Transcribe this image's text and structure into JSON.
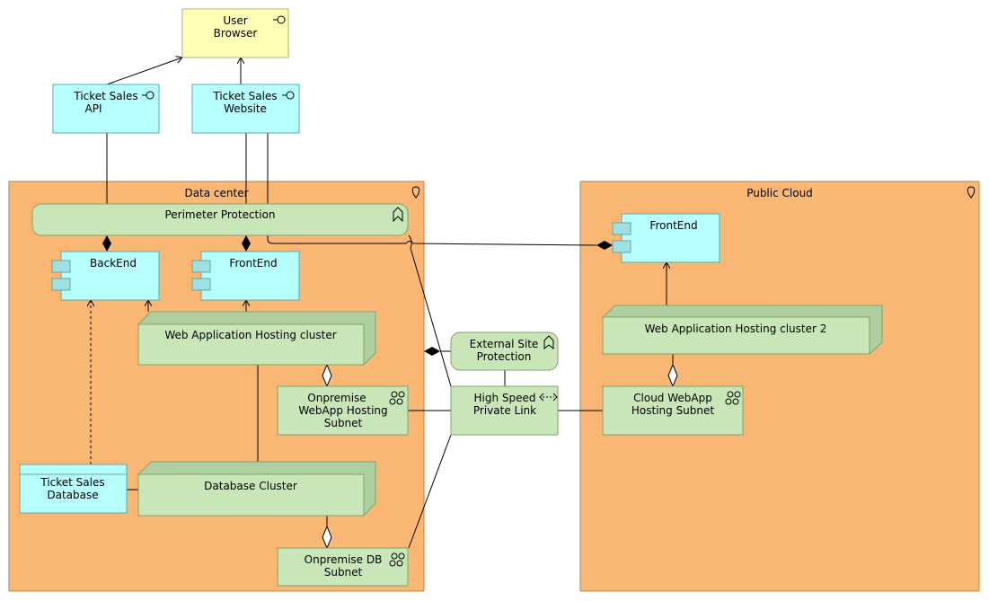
{
  "elements": {
    "user_browser": [
      "User",
      "Browser"
    ],
    "ticket_sales_api": [
      "Ticket Sales",
      "API"
    ],
    "ticket_sales_website": [
      "Ticket Sales",
      "Website"
    ],
    "data_center": "Data center",
    "public_cloud": "Public Cloud",
    "perimeter_protection": "Perimeter Protection",
    "backend": "BackEnd",
    "frontend": "FrontEnd",
    "web_app_cluster": "Web Application Hosting cluster",
    "onprem_webapp_subnet": [
      "Onpremise",
      "WebApp Hosting",
      "Subnet"
    ],
    "ticket_sales_db": [
      "Ticket Sales",
      "Database"
    ],
    "database_cluster": "Database Cluster",
    "onprem_db_subnet": [
      "Onpremise DB",
      "Subnet"
    ],
    "external_site_protection": [
      "External Site",
      "Protection"
    ],
    "high_speed_link": [
      "High Speed",
      "Private Link"
    ],
    "cloud_frontend": "FrontEnd",
    "web_app_cluster_2": "Web Application Hosting cluster 2",
    "cloud_webapp_subnet": [
      "Cloud WebApp",
      "Hosting Subnet"
    ]
  },
  "colors": {
    "location": "#f9b773",
    "application": "#b5ffff",
    "technology": "#c9e6b8",
    "business": "#ffffb5"
  }
}
